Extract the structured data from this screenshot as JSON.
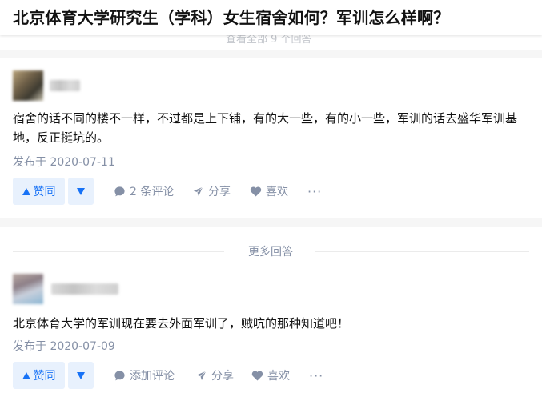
{
  "question": {
    "title": "北京体育大学研究生（学科）女生宿舍如何？军训怎么样啊？",
    "collapsed_hint": "查看全部 9 个回答"
  },
  "answers": [
    {
      "author": "",
      "content": "宿舍的话不同的楼不一样，不过都是上下铺，有的大一些，有的小一些，军训的话去盛华军训基地，反正挺坑的。",
      "date": "发布于 2020-07-11",
      "vote_up_label": "赞同",
      "comment_label": "2 条评论",
      "share_label": "分享",
      "like_label": "喜欢",
      "more_label": "···"
    },
    {
      "author": "",
      "content": "北京体育大学的军训现在要去外面军训了，贼吭的那种知道吧！",
      "date": "发布于 2020-07-09",
      "vote_up_label": "赞同",
      "comment_label": "添加评论",
      "share_label": "分享",
      "like_label": "喜欢",
      "more_label": "···"
    }
  ],
  "divider": {
    "label": "更多回答"
  },
  "colors": {
    "accent": "#1772f6",
    "accent_bg": "#e8f1fd",
    "meta_gray": "#8590a6",
    "text": "#121212",
    "page_bg": "#f6f6f6"
  },
  "icons": [
    "triangle-up-icon",
    "triangle-down-icon",
    "comment-icon",
    "share-plane-icon",
    "heart-icon",
    "more-dots-icon"
  ]
}
